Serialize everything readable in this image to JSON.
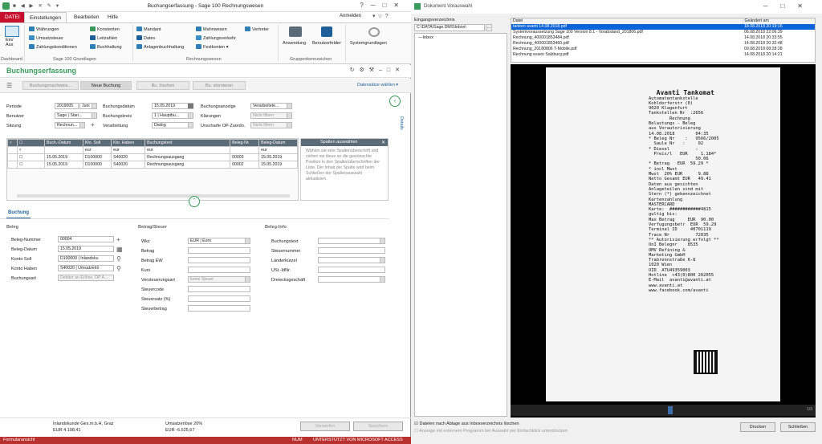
{
  "left": {
    "title": "Buchungserfassung - Sage 100 Rechnungswesen",
    "login": "Anmelden",
    "tabs": [
      "DATEI",
      "Einstellungen",
      "Bearbeiten",
      "Hilfe"
    ],
    "ribbon": {
      "dashboard": "Ein/\nAus",
      "dashboard_group": "Dashboard",
      "col1": [
        "Währungen",
        "Umsatzsteuer",
        "Zahlungskonditionen"
      ],
      "col2": [
        "Konstenten",
        "Leitzahlen",
        "Buchhaltung"
      ],
      "group1": "Sage 100 Grundlagen",
      "col3": [
        "Mandant",
        "Datev",
        "Anlagenbuchhaltung"
      ],
      "col4": [
        "Mahnwesen",
        "Zahlungsverkehr",
        "Festkonten"
      ],
      "col5": [
        "Vertreter"
      ],
      "group2": "Rechnungswesen",
      "big": [
        "Anwendung",
        "Benutzerfelder"
      ],
      "group3": "Gruppenkennzeichen",
      "sys": "Systemgrundlagen"
    },
    "doc_title": "Buchungserfassung",
    "cmd": [
      "Buchungsnachweis...",
      "Neue Buchung",
      "Bu. löschen",
      "Bu. stornieren"
    ],
    "datasets": "Datensätze wählen",
    "filters": {
      "periode_l": "Periode",
      "periode_v": "2019005",
      "periode_v2": "Juni",
      "benutzer_l": "Benutzer",
      "benutzer_v": "Sage | Stan...",
      "sitzung_l": "Sitzung",
      "sitzung_v": "Rechnun...",
      "bdatum_l": "Buchungsdatum",
      "bdatum_v": "15.05.2019",
      "bkreis_l": "Buchungskreis",
      "bkreis_v": "1 | Hauptbu...",
      "verarb_l": "Verarbeitung",
      "verarb_v": "Dialog",
      "banzeige_l": "Buchungsanzeige",
      "banzeige_v": "Verarbeitete...",
      "klaer_l": "Klärungen",
      "klaer_v": "Nicht filtern",
      "unsch_l": "Unscharfe OP-Zuordn.",
      "unsch_v": "Nicht filtern"
    },
    "details": "Details",
    "table": {
      "headers": [
        "Buch.-Datum",
        "Kto. Soll",
        "Kto. Haben",
        "Buchungstext",
        "Beleg-Nr.",
        "Beleg-Datum"
      ],
      "filters": [
        "",
        "eur",
        "eur",
        "eur",
        "",
        "eur"
      ],
      "rows": [
        [
          "15.05.2019",
          "D100000",
          "S40020",
          "Rechnungsausgang",
          "00003",
          "15.05.2019"
        ],
        [
          "15.05.2019",
          "D100000",
          "S40020",
          "Rechnungsausgang",
          "00002",
          "15.05.2019"
        ]
      ]
    },
    "colpanel": {
      "title": "Spalten auswählen",
      "text": "Wählen sie eine Spaltenüberschrift und ziehen sie diese an die gewünschte Position in den Spaltenüberschriften der Liste. Der Inhalt der Spalte wird beim Schließen der Spaltenauswahl aktualisiert."
    },
    "form_tab": "Buchung",
    "beleg": {
      "title": "Beleg",
      "rows": [
        [
          "Beleg-Nummer",
          "00004"
        ],
        [
          "Beleg-Datum",
          "15.05.2019"
        ],
        [
          "Konto Soll",
          "D100000 | Inlandsku"
        ],
        [
          "Konto Haben",
          "S40020 | Umsatzerlö"
        ],
        [
          "Buchungsart",
          "Debitor an Erlöse, OP A..."
        ]
      ]
    },
    "betrag": {
      "title": "Betrag/Steuer",
      "rows": [
        [
          "Wkz",
          "EUR | Euro"
        ],
        [
          "Betrag",
          ""
        ],
        [
          "Betrag EW",
          ""
        ],
        [
          "Kurs",
          ""
        ],
        [
          "Versteuerungsart",
          "keine Steuer"
        ],
        [
          "Steuercode",
          ""
        ],
        [
          "Steuersatz (%)",
          ""
        ],
        [
          "Steuerbetrag",
          ""
        ]
      ]
    },
    "info": {
      "title": "Beleg-Info",
      "rows": [
        "Buchungstext",
        "Steuernummer",
        "Länderkürzel",
        "USt.-IdNr.",
        "Dreiecksgeschäft"
      ]
    },
    "footer": {
      "a1": "Inlandskunde Ges.m.b.H, Graz",
      "a2": "EUR 4.108,41",
      "b1": "Umsatzerlöse 20%",
      "b2": "EUR -6.525,67",
      "verwerfen": "Verwerfen",
      "speichern": "Speichern"
    },
    "status": {
      "left": "Formularansicht",
      "num": "NUM",
      "access": "UNTERSTÜTZT VON MICROSOFT ACCESS"
    }
  },
  "right": {
    "title": "Dokument Vorauswahl",
    "eingang_label": "Eingangsverzeichnis",
    "eingang_path": "C:\\DATA\\Sage.DMS\\Inbox\\",
    "tree": "Inbox",
    "cols": [
      "Datei",
      "Geändert am"
    ],
    "files": [
      [
        "tanken avanti 14.08.2018.pdf",
        "18.08.2018 20:19:15"
      ],
      [
        "Systemvoraussetzung Sage 100 Version 8.1 - Vorabstand_201806.pdf",
        "06.08.2018 22:06:39"
      ],
      [
        "Rechnung_400001853484.pdf",
        "14.08.2018 20:33:55"
      ],
      [
        "Rechnung_400001853460.pdf",
        "14.08.2018 20:32:48"
      ],
      [
        "Rechnung_20180806 T-Mobile.pdf",
        "09.08.2018 08:28:28"
      ],
      [
        "Rechnung essen Salzburg.pdf",
        "14.08.2018 20:14:21"
      ]
    ],
    "receipt": [
      "  Avanti Tankomat",
      "Automatentankstelle",
      "Kohldorferstr (0)",
      "9020 Klagenfurt",
      "Tankstellen Nr  :2656",
      "",
      "        Rechnung",
      "",
      "Belastungs - Beleg",
      "aus Vorautorisierung",
      "",
      "14.08.2018        04:35",
      "",
      "* Beleg Nr    :   9566/2005",
      "  Saule Nr   :     02",
      "* Diesel          :",
      "  Preis/l   EUR     1.184*",
      "                  50.06",
      "* Betrag   EUR  59.29 *",
      "* incl Mwst",
      "",
      "Mwst  20% EUR      9.88",
      "",
      "Netto Gesamt EUR   49.41",
      "",
      "Daten aus gesichten",
      "Anlageteilen sind mit",
      "Stern (*) gekennzeichnet",
      "",
      "Kartenzahlung",
      "MASTERCARD",
      "Karte:  ############4815",
      "gultig bis:",
      "Max Betrag     EUR  90.00",
      "Verfugungsbetr  EUR  59.29",
      "Terminal ID     40701119",
      "Trace Nr          72035",
      "** Autorisierung erfolgt **",
      "",
      "OnI Belegnr    8535",
      "OMV Refining &",
      "Marketing GmbH",
      "Trabrennstraße 6-8",
      "1020 Wien",
      "UID  ATU49359003",
      "Hotline  +43(0)800 202055",
      "E-Mail  avanti@avanti.at",
      "",
      "www.avanti.at",
      "www.facebook.com/avanti"
    ],
    "page": "1/3",
    "check1": "Dateien nach Ablage aus Inboxverzeichnis löschen",
    "check2": "Anzeige mit externem Programm bei Auswahl per Einfachklick unterdrücken",
    "drucken": "Drucken",
    "schliessen": "Schließen"
  },
  "colors": {
    "brand": "#c8102e",
    "status": "#b8312f",
    "select": "#0a64d8",
    "grid": "#5c6b78",
    "green": "#3a9a5a"
  }
}
